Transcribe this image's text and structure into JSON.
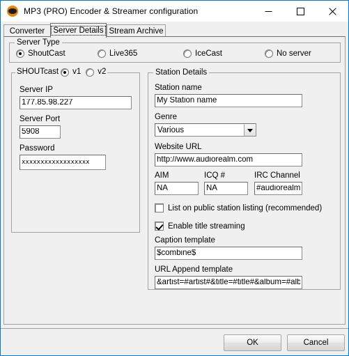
{
  "window": {
    "title": "MP3 (PRO) Encoder & Streamer configuration",
    "icon": "app-disc-icon",
    "accent_color": "#0078d7",
    "background_color": "#f0f0f0",
    "controls": {
      "minimize": "minimize-icon",
      "maximize": "maximize-icon",
      "close": "close-icon"
    }
  },
  "tabs": [
    {
      "label": "Converter",
      "active": false
    },
    {
      "label": "Server Details",
      "active": true
    },
    {
      "label": "Stream Archive",
      "active": false
    }
  ],
  "server_type": {
    "legend": "Server Type",
    "options": [
      {
        "label": "ShoutCast",
        "selected": true
      },
      {
        "label": "Live365",
        "selected": false
      },
      {
        "label": "IceCast",
        "selected": false
      },
      {
        "label": "No server",
        "selected": false
      }
    ]
  },
  "shoutcast": {
    "legend": "SHOUTcast",
    "versions": [
      {
        "label": "v1",
        "selected": true
      },
      {
        "label": "v2",
        "selected": false
      }
    ],
    "server_ip": {
      "label": "Server IP",
      "value": "177.85.98.227"
    },
    "server_port": {
      "label": "Server Port",
      "value": "5908"
    },
    "password": {
      "label": "Password",
      "value": "xxxxxxxxxxxxxxxxxx"
    }
  },
  "station_details": {
    "legend": "Station Details",
    "station_name": {
      "label": "Station name",
      "value": "My Station name"
    },
    "genre": {
      "label": "Genre",
      "value": "Various",
      "arrow": "chevron-down-icon"
    },
    "website_url": {
      "label": "Website URL",
      "value": "http://www.audiorealm.com"
    },
    "aim": {
      "label": "AIM",
      "value": "NA"
    },
    "icq": {
      "label": "ICQ #",
      "value": "NA"
    },
    "irc": {
      "label": "IRC Channel",
      "value": "#audiorealm"
    },
    "list_public": {
      "label": "List on public station listing (recommended)",
      "checked": false
    },
    "title_streaming": {
      "label": "Enable title streaming",
      "checked": true
    },
    "caption_template": {
      "label": "Caption template",
      "value": "$combine$"
    },
    "url_append_template": {
      "label": "URL Append template",
      "value": "&artist=#artist#&title=#title#&album=#album#"
    }
  },
  "footer": {
    "ok_label": "OK",
    "cancel_label": "Cancel"
  }
}
